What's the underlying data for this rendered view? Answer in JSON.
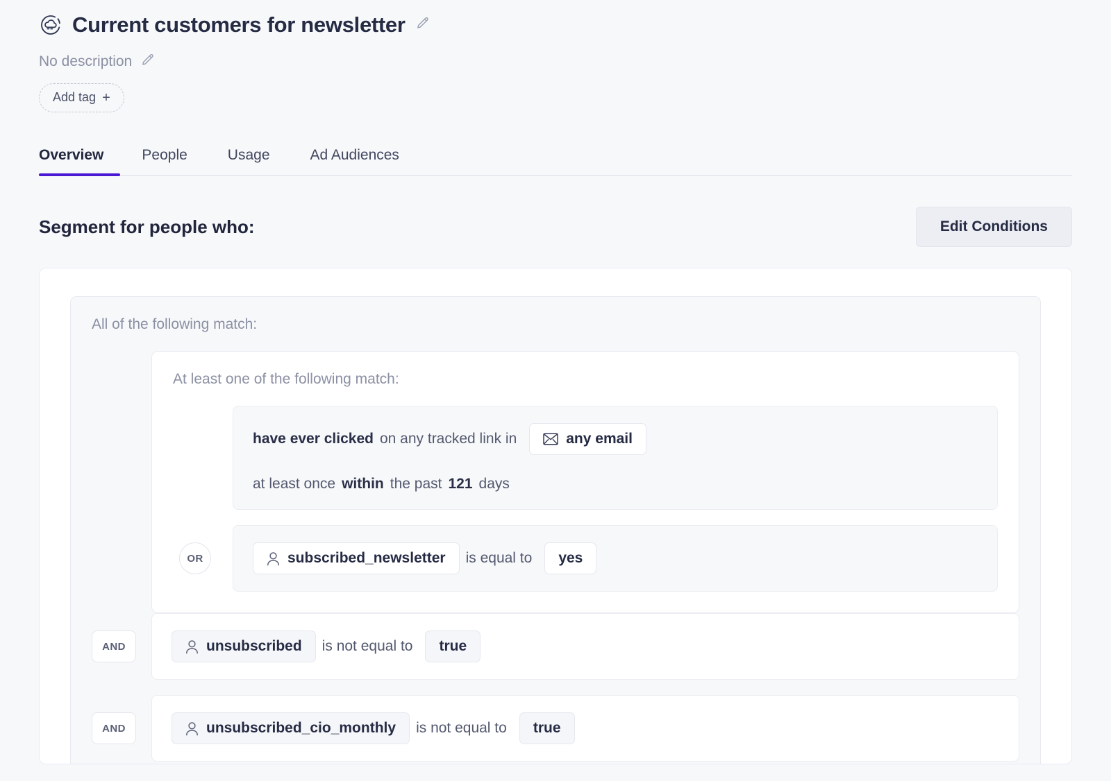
{
  "accent_color": "#4a18d4",
  "header": {
    "brand_icon": "cloud-in-circle-icon",
    "title": "Current customers for newsletter",
    "title_edit_icon": "pencil-icon",
    "description": "No description",
    "description_edit_icon": "pencil-icon",
    "add_tag_label": "Add tag",
    "add_tag_plus": "+"
  },
  "tabs": [
    {
      "label": "Overview",
      "active": true
    },
    {
      "label": "People",
      "active": false
    },
    {
      "label": "Usage",
      "active": false
    },
    {
      "label": "Ad Audiences",
      "active": false
    }
  ],
  "segment": {
    "heading": "Segment for people who:",
    "edit_button": "Edit Conditions",
    "all_group_label": "All of the following match:",
    "any_group_label": "At least one of the following match:",
    "any_group_rules": [
      {
        "joiner": "",
        "line1_bold": "have ever clicked",
        "line1_text": "on any tracked link in",
        "line1_chip": {
          "icon": "envelope-icon",
          "label": "any email"
        },
        "line2_pre": "at least once",
        "line2_bold": "within",
        "line2_mid": "the past",
        "line2_bold2": "121",
        "line2_post": "days"
      },
      {
        "joiner": "OR",
        "attribute": {
          "icon": "person-icon",
          "label": "subscribed_newsletter"
        },
        "operator": "is equal to",
        "value": "yes"
      }
    ],
    "and_rules": [
      {
        "joiner": "AND",
        "attribute": {
          "icon": "person-icon",
          "label": "unsubscribed"
        },
        "operator": "is not equal to",
        "value": "true"
      },
      {
        "joiner": "AND",
        "attribute": {
          "icon": "person-icon",
          "label": "unsubscribed_cio_monthly"
        },
        "operator": "is not equal to",
        "value": "true"
      }
    ]
  }
}
